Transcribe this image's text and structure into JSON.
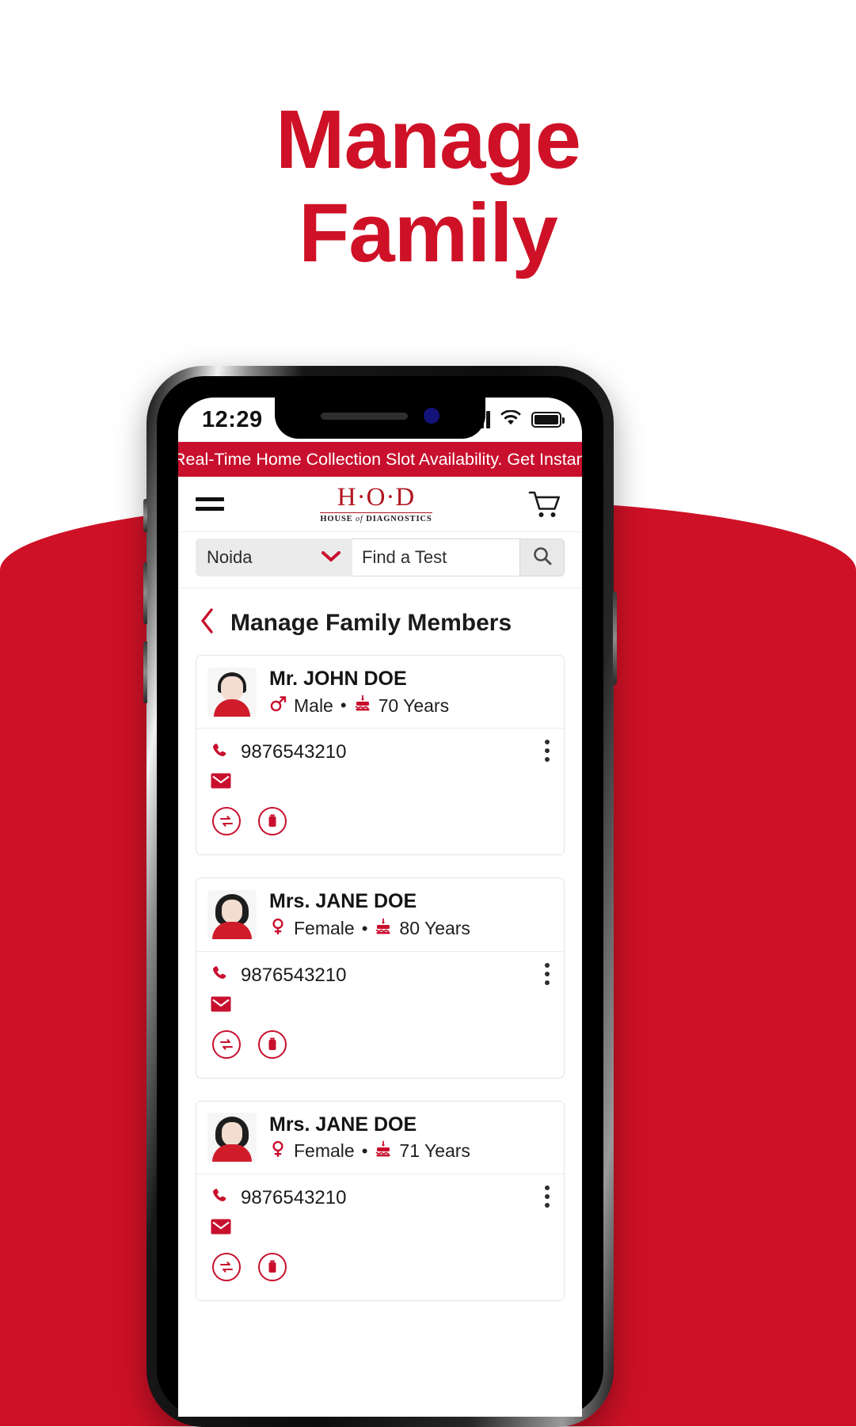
{
  "headline": {
    "line1": "Manage",
    "line2": "Family",
    "color": "#CE1126"
  },
  "phone": {
    "status_bar": {
      "time": "12:29",
      "signal_icon": "cellular-signal-icon",
      "wifi_icon": "wifi-icon",
      "battery_icon": "battery-full-icon"
    },
    "promo_banner": {
      "text": "Real-Time Home Collection Slot Availability. Get Instant Booking Conf",
      "bg": "#C8102E"
    },
    "app_header": {
      "menu_icon": "hamburger-menu-icon",
      "logo_main": "H·O·D",
      "logo_sub_pre": "HOUSE ",
      "logo_sub_em": "of",
      "logo_sub_post": " DIAGNOSTICS",
      "cart_icon": "shopping-cart-icon"
    },
    "search": {
      "city_value": "Noida",
      "city_chevron": "chevron-down-icon",
      "find_value": "Find a Test",
      "search_icon": "search-icon"
    },
    "page": {
      "back_icon": "chevron-left-icon",
      "title": "Manage Family Members"
    },
    "members": [
      {
        "avatar": "male-avatar",
        "name": "Mr. JOHN DOE",
        "gender_icon": "male-gender-icon",
        "gender": "Male",
        "separator": "•",
        "age_icon": "birthday-cake-icon",
        "age": "70 Years",
        "phone_icon": "phone-icon",
        "phone": "9876543210",
        "email_icon": "email-icon",
        "menu_icon": "more-vertical-icon",
        "action_switch": "switch-profile-icon",
        "action_delete": "delete-icon"
      },
      {
        "avatar": "female-avatar",
        "name": "Mrs. JANE DOE",
        "gender_icon": "female-gender-icon",
        "gender": "Female",
        "separator": "•",
        "age_icon": "birthday-cake-icon",
        "age": "80 Years",
        "phone_icon": "phone-icon",
        "phone": "9876543210",
        "email_icon": "email-icon",
        "menu_icon": "more-vertical-icon",
        "action_switch": "switch-profile-icon",
        "action_delete": "delete-icon"
      },
      {
        "avatar": "female-avatar",
        "name": "Mrs. JANE DOE",
        "gender_icon": "female-gender-icon",
        "gender": "Female",
        "separator": "•",
        "age_icon": "birthday-cake-icon",
        "age": "71 Years",
        "phone_icon": "phone-icon",
        "phone": "9876543210",
        "email_icon": "email-icon",
        "menu_icon": "more-vertical-icon",
        "action_switch": "switch-profile-icon",
        "action_delete": "delete-icon"
      }
    ]
  },
  "theme": {
    "brand_red": "#C8102E",
    "banner_red": "#CE1126",
    "logo_red": "#B01520"
  }
}
